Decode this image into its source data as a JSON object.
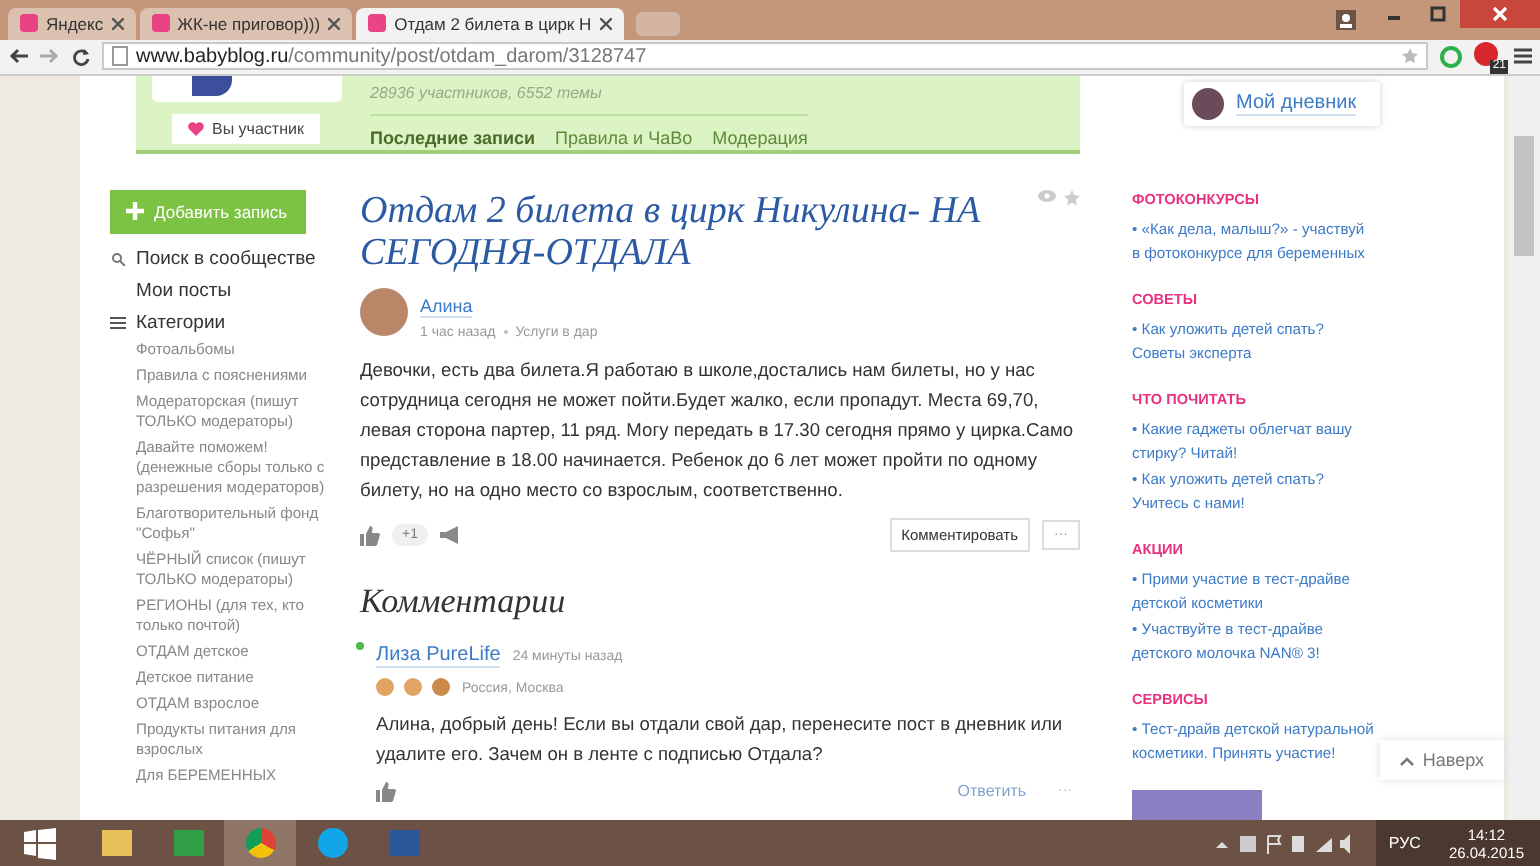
{
  "browser": {
    "tabs": [
      {
        "label": "Яндекс",
        "selected": false
      },
      {
        "label": "ЖК-не приговор)))",
        "selected": false
      },
      {
        "label": "Отдам 2 билета в цирк Н",
        "selected": true
      }
    ],
    "url": {
      "domain": "www.babyblog.ru",
      "path": "/community/post/otdam_darom/3128747"
    },
    "extension_badge": "21"
  },
  "community": {
    "members_info": "28936 участников, 6552 темы",
    "member_button": "Вы участник",
    "nav": [
      {
        "label": "Последние записи",
        "selected": true
      },
      {
        "label": "Правила и ЧаВо",
        "selected": false
      },
      {
        "label": "Модерация",
        "selected": false
      }
    ]
  },
  "diary_link": "Мой дневник",
  "sidebar": {
    "add_button": "Добавить запись",
    "search": "Поиск в сообществе",
    "my_posts": "Мои посты",
    "categories_label": "Категории",
    "categories": [
      "Фотоальбомы",
      "Правила с пояснениями",
      "Модераторская (пишут ТОЛЬКО модераторы)",
      "Давайте поможем! (денежные сборы только с разрешения модераторов)",
      "Благотворительный фонд \"Софья\"",
      "ЧЁРНЫЙ список (пишут ТОЛЬКО модераторы)",
      "РЕГИОНЫ (для тех, кто только почтой)",
      "ОТДАМ детское",
      "Детское питание",
      "ОТДАМ взрослое",
      "Продукты питания для взрослых",
      "Для БЕРЕМЕННЫХ"
    ]
  },
  "post": {
    "title": "Отдам 2 билета в цирк Никулина- НА СЕГОДНЯ-ОТДАЛА",
    "author": "Алина",
    "time": "1 час назад",
    "category": "Услуги в дар",
    "body": "Девочки, есть два билета.Я работаю в школе,достались нам билеты, но у нас сотрудница сегодня не может пойти.Будет жалко, если пропадут. Места 69,70, левая сторона партер, 11 ряд. Могу передать в 17.30 сегодня прямо у цирка.Само представление в 18.00 начинается. Ребенок до 6 лет может пройти по одному билету, но на одно место со взрослым, соответственно.",
    "likes": "+1",
    "comment_button": "Комментировать",
    "more": "···"
  },
  "comments_heading": "Комментарии",
  "comments": [
    {
      "author": "Лиза PureLife",
      "online": true,
      "time": "24 минуты назад",
      "location": "Россия, Москва",
      "body": "Алина, добрый день! Если вы отдали свой дар, перенесите пост в дневник или удалите его. Зачем он в ленте с подписью Отдала?",
      "reply": "Ответить",
      "more": "···"
    }
  ],
  "right": [
    {
      "title": "ФОТОКОНКУРСЫ",
      "links": [
        "• «Как дела, малыш?» - участвуй в фотоконкурсе для беременных"
      ]
    },
    {
      "title": "СОВЕТЫ",
      "links": [
        "• Как уложить детей спать? Советы эксперта"
      ]
    },
    {
      "title": "ЧТО ПОЧИТАТЬ",
      "links": [
        "• Какие гаджеты облегчат вашу стирку? Читай!",
        "• Как уложить детей спать? Учитесь с нами!"
      ]
    },
    {
      "title": "АКЦИИ",
      "links": [
        "• Прими участие в тест-драйве детской косметики",
        "• Участвуйте в тест-драйве детского молочка NAN® 3!"
      ]
    },
    {
      "title": "СЕРВИСЫ",
      "links": [
        "• Тест-драйв детской натуральной косметики. Принять участие!"
      ]
    }
  ],
  "to_top": "Наверх",
  "taskbar": {
    "language": "РУС",
    "time": "14:12",
    "date": "26.04.2015"
  }
}
